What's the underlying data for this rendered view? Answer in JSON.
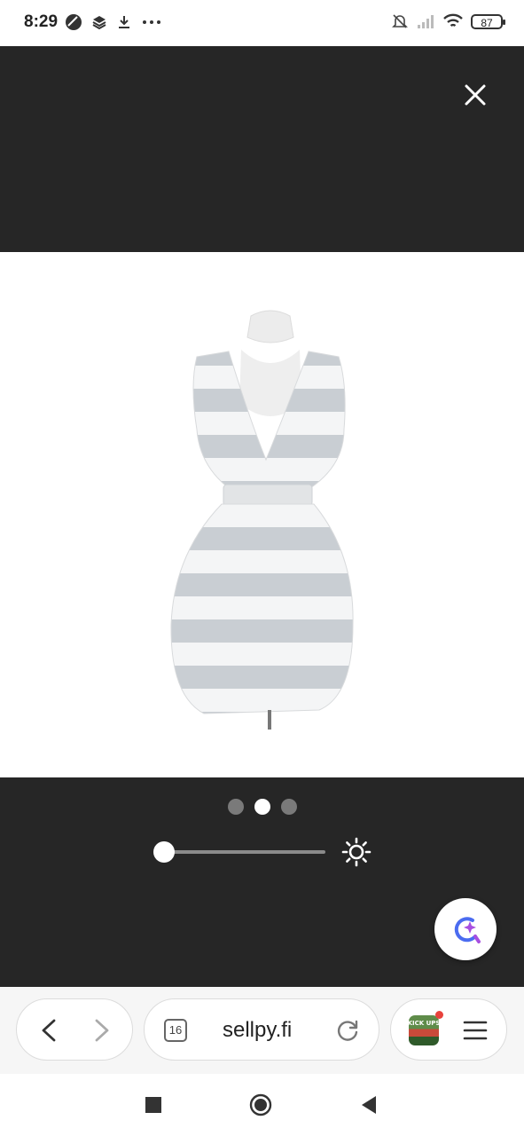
{
  "status_bar": {
    "time": "8:29",
    "battery_level": "87",
    "left_icons": [
      "app-circle-icon",
      "stack-icon",
      "download-icon",
      "more-dots-icon"
    ],
    "right_icons": [
      "bell-muted-icon",
      "signal-icon",
      "wifi-icon",
      "battery-icon"
    ]
  },
  "viewer": {
    "background_color": "#262626",
    "image_subject": "dress-photo",
    "dots": {
      "count": 3,
      "active_index": 1
    },
    "brightness_level": 0
  },
  "browser": {
    "tab_count": "16",
    "url": "sellpy.fi",
    "thumbnail_text": "KICK UPS"
  },
  "colors": {
    "dark_bg": "#262626",
    "badge_red": "#e8423c",
    "assistant_blue": "#4b6cf0",
    "assistant_purple": "#a84fe0"
  }
}
